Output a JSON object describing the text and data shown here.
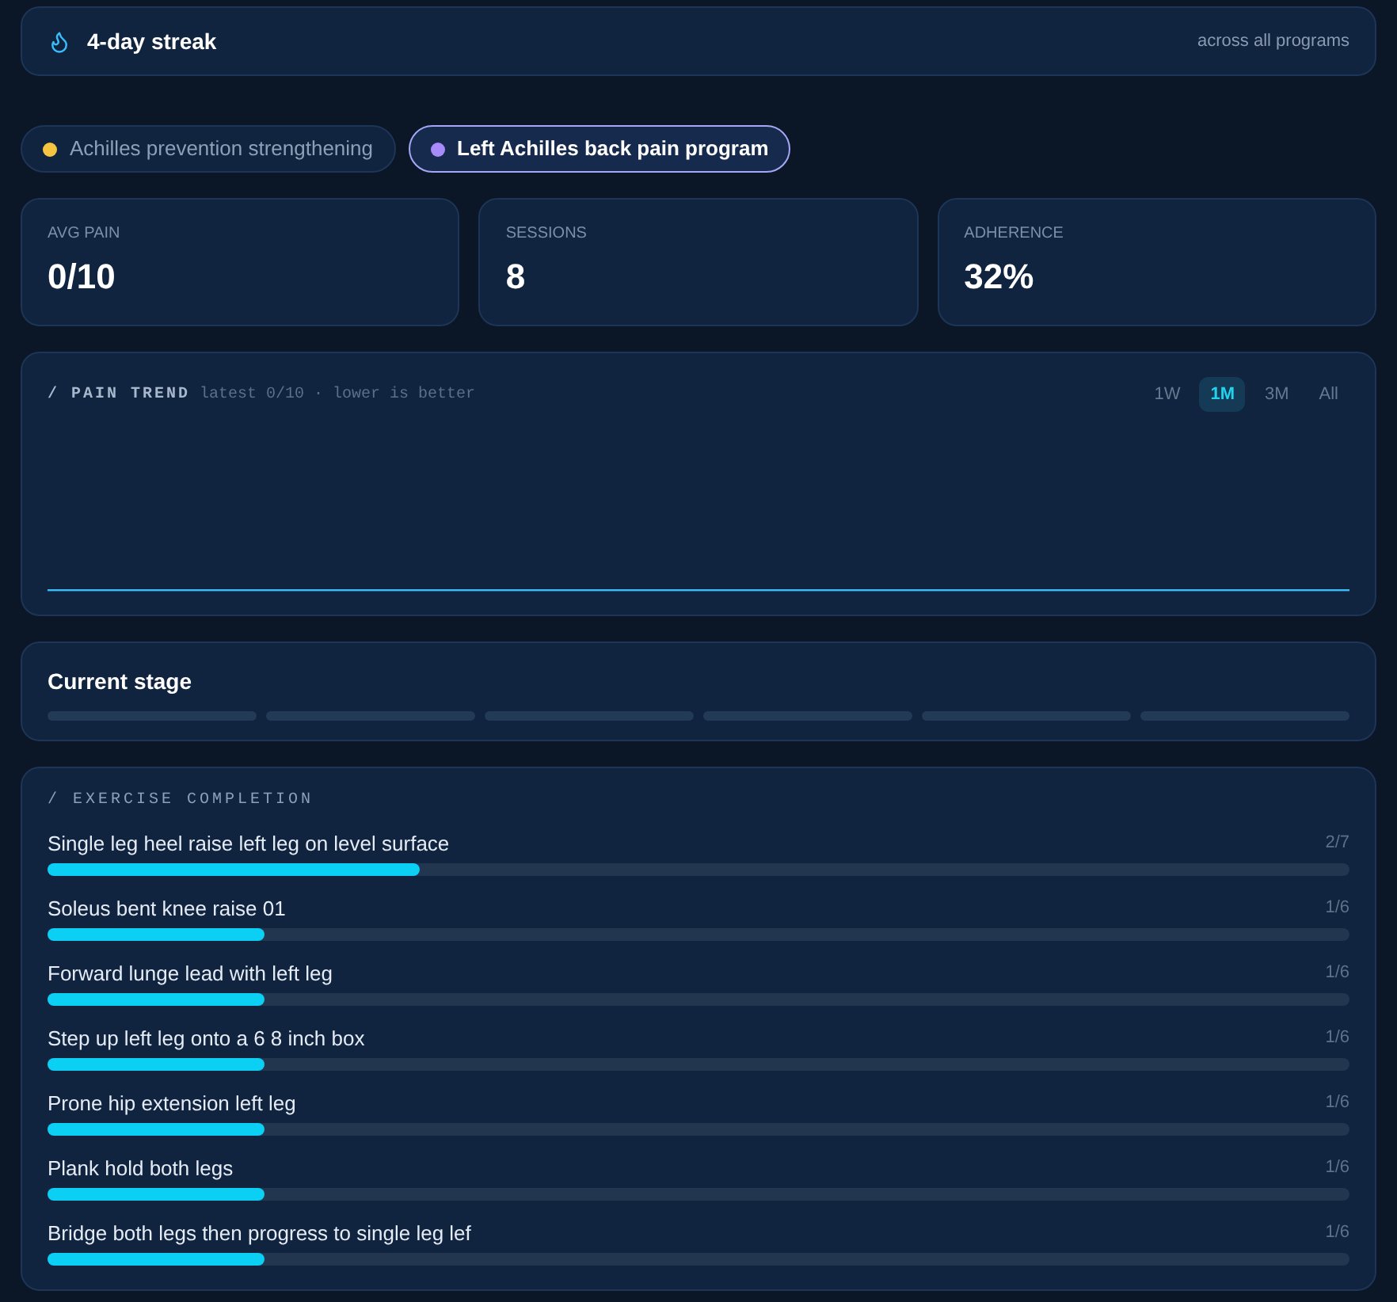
{
  "streak": {
    "title": "4-day streak",
    "scope": "across all programs"
  },
  "programs": [
    {
      "label": "Achilles prevention strengthening",
      "color": "#f5c542",
      "selected": false
    },
    {
      "label": "Left Achilles back pain program",
      "color": "#a78bfa",
      "selected": true
    }
  ],
  "stats": [
    {
      "label": "AVG PAIN",
      "value": "0/10"
    },
    {
      "label": "SESSIONS",
      "value": "8"
    },
    {
      "label": "ADHERENCE",
      "value": "32%"
    }
  ],
  "pain_trend": {
    "title": "/ PAIN TREND",
    "subtitle": "latest 0/10 · lower is better",
    "ranges": [
      {
        "label": "1W",
        "selected": false
      },
      {
        "label": "1M",
        "selected": true
      },
      {
        "label": "3M",
        "selected": false
      },
      {
        "label": "All",
        "selected": false
      }
    ]
  },
  "current_stage": {
    "title": "Current stage",
    "segments": [
      {
        "filled": false
      },
      {
        "filled": false
      },
      {
        "filled": false
      },
      {
        "filled": false
      },
      {
        "filled": false
      },
      {
        "filled": false
      }
    ]
  },
  "exercise_completion": {
    "title": "/ EXERCISE COMPLETION",
    "exercises": [
      {
        "name": "Single leg heel raise left leg on level surface",
        "count": "2/7",
        "level": 0.286
      },
      {
        "name": "Soleus bent knee raise 01",
        "count": "1/6",
        "level": 0.167
      },
      {
        "name": "Forward lunge lead with left leg",
        "count": "1/6",
        "level": 0.167
      },
      {
        "name": "Step up left leg onto a 6 8 inch box",
        "count": "1/6",
        "level": 0.167
      },
      {
        "name": "Prone hip extension left leg",
        "count": "1/6",
        "level": 0.167
      },
      {
        "name": "Plank hold both legs",
        "count": "1/6",
        "level": 0.167
      },
      {
        "name": "Bridge both legs then progress to single leg lef",
        "count": "1/6",
        "level": 0.167
      }
    ]
  }
}
